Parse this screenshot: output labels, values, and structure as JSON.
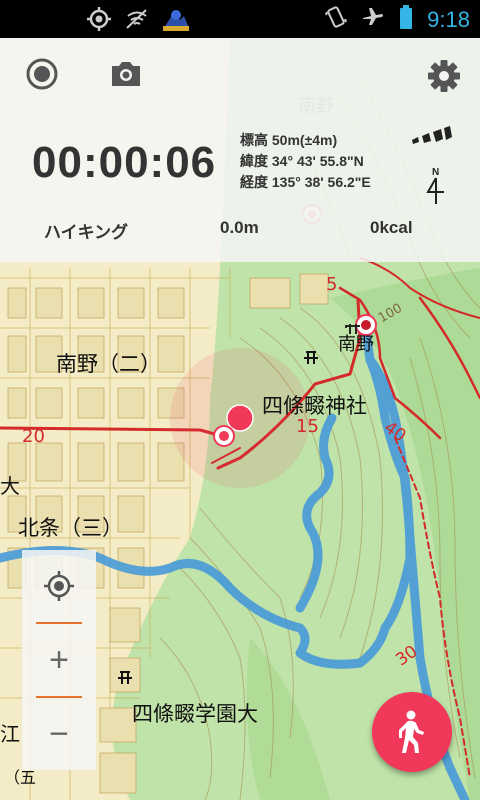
{
  "status_bar": {
    "time": "9:18",
    "icons": [
      "gps-icon",
      "wifi-off-icon",
      "app-notification-icon",
      "vibrate-icon",
      "airplane-mode-icon",
      "battery-icon"
    ]
  },
  "panel": {
    "timer": "00:00:06",
    "altitude": "標高 50m(±4m)",
    "latitude": "緯度 34° 43' 55.8\"N",
    "longitude": "経度 135° 38' 56.2\"E",
    "activity": "ハイキング",
    "distance": "0.0m",
    "calories": "0kcal",
    "compass_label": "N"
  },
  "map": {
    "labels": {
      "minamino2": "南野（二）",
      "shrine": "四條畷神社",
      "kitajo3": "北条（三）",
      "university": "四條畷学園大",
      "minamino_top": "南野",
      "minamino_right": "南野",
      "dai": "大",
      "kou": "江",
      "go": "（五",
      "road20": "20",
      "road15": "15",
      "road5": "5",
      "road40": "40",
      "road30": "30",
      "contour100": "100"
    },
    "colors": {
      "water": "#4a9bd8",
      "road": "#d42a2a",
      "forest": "#bfe3a8",
      "urban": "#f4ecc6",
      "accent": "#f0385a"
    }
  },
  "controls": {
    "zoom_in_symbol": "+",
    "zoom_out_symbol": "−"
  }
}
